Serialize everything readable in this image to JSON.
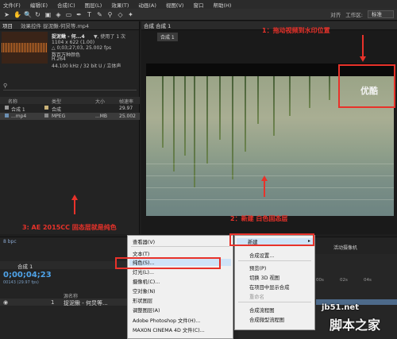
{
  "menubar": [
    "文件(F)",
    "编辑(E)",
    "合成(C)",
    "图层(L)",
    "效果(T)",
    "动画(A)",
    "视图(V)",
    "窗口",
    "帮助(H)"
  ],
  "toolbar": {
    "align": "对齐",
    "workspace_label": "工作区:",
    "workspace_value": "标准"
  },
  "project": {
    "tab_project": "项目",
    "tab_effects": "效果控件 捉泥鳅-何炅等.mp4",
    "file_name": "捉泥鳅 - 何...4",
    "used": "▼, 使用了 1 次",
    "info_lines": [
      "1104 x 622 (1.00)",
      "△ 0;03;27;03, 25.002 fps",
      "数百万种颜色",
      "H.264",
      "44.100 kHz / 32 bit U / 立体声"
    ],
    "search_icon": "search-icon",
    "columns": {
      "name": "名称",
      "type": "类型",
      "size": "大小",
      "rate": "帧速率"
    },
    "rows": [
      {
        "name": "合成 1",
        "type": "合成",
        "size": "",
        "rate": "29.97",
        "color": "#a0a0a0"
      },
      {
        "name": "...mp4",
        "type": "MPEG",
        "size": "...MB",
        "rate": "25.002",
        "color": "#7a7a7a"
      }
    ]
  },
  "viewer": {
    "tab": "合成 合成 1",
    "breadcrumb": "合成 1"
  },
  "annotations": {
    "a1": "1：拖动视频到水印位置",
    "a2": "2：新建 白色固态层",
    "a3": "3: AE 2015CC 固态层就是纯色"
  },
  "watermark": "优酷",
  "timeline": {
    "bpc": "8 bpc",
    "comp_tab": "合成 1",
    "timecode": "0;00;04;23",
    "fps": "00143 (29.97 fps)",
    "layer_num": "1",
    "layer_name": "捉泥鳅 - 何炅等...",
    "source_col": "源名称",
    "cam": "活动摄像机",
    "ticks": [
      "00s",
      "02s",
      "04s"
    ]
  },
  "menu_main": [
    "查看器(V)",
    "文本(T)",
    "纯色(S)...",
    "灯光(L)...",
    "摄像机(C)...",
    "空对象(N)",
    "形状图层",
    "调整图层(A)",
    "Adobe Photoshop 文件(H)...",
    "MAXON CINEMA 4D 文件(C)..."
  ],
  "menu_sub": [
    "新建",
    "合成设置...",
    "预览(P)",
    "切换 3D 视图",
    "在项目中显示合成",
    "重命名",
    "合成流程图",
    "合成微型流程图"
  ],
  "site": {
    "url": "jb51.net",
    "name": "脚本之家"
  },
  "colors": {
    "accent": "#e8322a"
  }
}
